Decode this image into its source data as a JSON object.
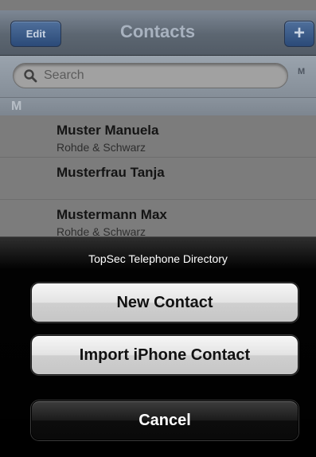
{
  "navbar": {
    "edit_label": "Edit",
    "title": "Contacts",
    "add_label": "+"
  },
  "search": {
    "placeholder": "Search",
    "index_letter": "M"
  },
  "section": {
    "letter": "M"
  },
  "contacts": [
    {
      "name": "Muster Manuela",
      "company": "Rohde & Schwarz"
    },
    {
      "name": "Musterfrau Tanja",
      "company": ""
    },
    {
      "name": "Mustermann Max",
      "company": "Rohde & Schwarz"
    }
  ],
  "action_sheet": {
    "title": "TopSec Telephone Directory",
    "new_contact_label": "New Contact",
    "import_label": "Import iPhone Contact",
    "cancel_label": "Cancel"
  },
  "colors": {
    "nav_button_blue": "#2b4a78",
    "sheet_background": "#000000"
  }
}
